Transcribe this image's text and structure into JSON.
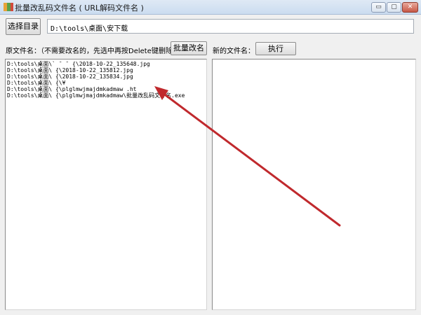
{
  "window": {
    "title": "批量改乱码文件名 ( URL解码文件名 )",
    "controls": {
      "minimize": "▭",
      "restore": "▢",
      "close": "✕"
    }
  },
  "toolbar": {
    "select_dir_label": "选择目录",
    "path_value": "D:\\tools\\桌面\\安下载"
  },
  "left_panel": {
    "label": "原文件名：（不需要改名的，先选中再按Delete键删除）",
    "batch_rename_label": "批量改名",
    "items": [
      "D:\\tools\\桌面\\` ¯ ¯ {\\2018-10-22_135648.jpg",
      "D:\\tools\\桌面\\    {\\2018-10-22_135812.jpg",
      "D:\\tools\\桌面\\    {\\2018-10-22_135834.jpg",
      "D:\\tools\\桌面\\    {\\¥",
      "D:\\tools\\桌面\\    {\\plglmwjmajdmkadmaw    .ht",
      "D:\\tools\\桌面\\    {\\plglmwjmajdmkadmaw\\批量改乱码文件名.exe"
    ]
  },
  "right_panel": {
    "label": "新的文件名：",
    "execute_label": "执行",
    "items": []
  },
  "colors": {
    "arrow": "#c0292d",
    "window_bg": "#f0f0f0"
  }
}
